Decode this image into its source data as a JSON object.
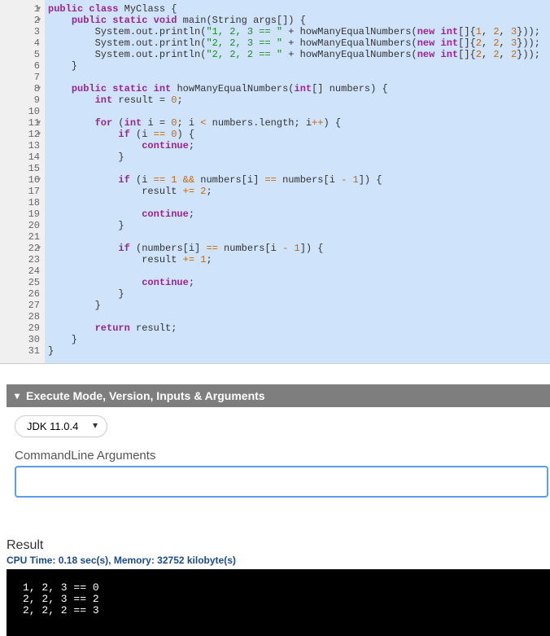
{
  "editor": {
    "gutter": [
      {
        "n": 1,
        "fold": true
      },
      {
        "n": 2,
        "fold": true
      },
      {
        "n": 3,
        "fold": false
      },
      {
        "n": 4,
        "fold": false
      },
      {
        "n": 5,
        "fold": false
      },
      {
        "n": 6,
        "fold": false
      },
      {
        "n": 7,
        "fold": false
      },
      {
        "n": 8,
        "fold": true
      },
      {
        "n": 9,
        "fold": false
      },
      {
        "n": 10,
        "fold": false
      },
      {
        "n": 11,
        "fold": true
      },
      {
        "n": 12,
        "fold": true
      },
      {
        "n": 13,
        "fold": false
      },
      {
        "n": 14,
        "fold": false
      },
      {
        "n": 15,
        "fold": false
      },
      {
        "n": 16,
        "fold": true
      },
      {
        "n": 17,
        "fold": false
      },
      {
        "n": 18,
        "fold": false
      },
      {
        "n": 19,
        "fold": false
      },
      {
        "n": 20,
        "fold": false
      },
      {
        "n": 21,
        "fold": false
      },
      {
        "n": 22,
        "fold": true
      },
      {
        "n": 23,
        "fold": false
      },
      {
        "n": 24,
        "fold": false
      },
      {
        "n": 25,
        "fold": false
      },
      {
        "n": 26,
        "fold": false
      },
      {
        "n": 27,
        "fold": false
      },
      {
        "n": 28,
        "fold": false
      },
      {
        "n": 29,
        "fold": false
      },
      {
        "n": 30,
        "fold": false
      },
      {
        "n": 31,
        "fold": false
      }
    ],
    "code": {
      "l1": {
        "a": "public ",
        "b": "class ",
        "c": "MyClass {"
      },
      "l2": {
        "a": "    ",
        "b": "public ",
        "c": "static ",
        "d": "void ",
        "e": "main(String args[]) {"
      },
      "l3": {
        "a": "        System.out.println(",
        "b": "\"1, 2, 3 == \"",
        "c": " + howManyEqualNumbers(",
        "d": "new ",
        "e": "int",
        "f": "[]{",
        "g": "1",
        "h": ", ",
        "i": "2",
        "j": ", ",
        "k": "3",
        "l": "}));"
      },
      "l4": {
        "a": "        System.out.println(",
        "b": "\"2, 2, 3 == \"",
        "c": " + howManyEqualNumbers(",
        "d": "new ",
        "e": "int",
        "f": "[]{",
        "g": "2",
        "h": ", ",
        "i": "2",
        "j": ", ",
        "k": "3",
        "l": "}));"
      },
      "l5": {
        "a": "        System.out.println(",
        "b": "\"2, 2, 2 == \"",
        "c": " + howManyEqualNumbers(",
        "d": "new ",
        "e": "int",
        "f": "[]{",
        "g": "2",
        "h": ", ",
        "i": "2",
        "j": ", ",
        "k": "2",
        "l": "}));"
      },
      "l6": {
        "a": "    }"
      },
      "l7": {
        "a": ""
      },
      "l8": {
        "a": "    ",
        "b": "public ",
        "c": "static ",
        "d": "int ",
        "e": "howManyEqualNumbers(",
        "f": "int",
        "g": "[] numbers) {"
      },
      "l9": {
        "a": "        ",
        "b": "int ",
        "c": "result = ",
        "d": "0",
        "e": ";"
      },
      "l10": {
        "a": ""
      },
      "l11": {
        "a": "        ",
        "b": "for ",
        "c": "(",
        "d": "int ",
        "e": "i = ",
        "f": "0",
        "g": "; i ",
        "h": "<",
        "i": " numbers.length; i",
        "j": "++",
        "k": ") {"
      },
      "l12": {
        "a": "            ",
        "b": "if ",
        "c": "(i ",
        "d": "==",
        "e": " ",
        "f": "0",
        "g": ") {"
      },
      "l13": {
        "a": "                ",
        "b": "continue",
        "c": ";"
      },
      "l14": {
        "a": "            }"
      },
      "l15": {
        "a": ""
      },
      "l16": {
        "a": "            ",
        "b": "if ",
        "c": "(i ",
        "d": "==",
        "e": " ",
        "f": "1",
        "g": " ",
        "h": "&&",
        "i": " numbers[i] ",
        "j": "==",
        "k": " numbers[i ",
        "l": "-",
        "m": " ",
        "n": "1",
        "o": "]) {"
      },
      "l17": {
        "a": "                result ",
        "b": "+=",
        "c": " ",
        "d": "2",
        "e": ";"
      },
      "l18": {
        "a": ""
      },
      "l19": {
        "a": "                ",
        "b": "continue",
        "c": ";"
      },
      "l20": {
        "a": "            }"
      },
      "l21": {
        "a": ""
      },
      "l22": {
        "a": "            ",
        "b": "if ",
        "c": "(numbers[i] ",
        "d": "==",
        "e": " numbers[i ",
        "f": "-",
        "g": " ",
        "h": "1",
        "i": "]) {"
      },
      "l23": {
        "a": "                result ",
        "b": "+=",
        "c": " ",
        "d": "1",
        "e": ";"
      },
      "l24": {
        "a": ""
      },
      "l25": {
        "a": "                ",
        "b": "continue",
        "c": ";"
      },
      "l26": {
        "a": "            }"
      },
      "l27": {
        "a": "        }"
      },
      "l28": {
        "a": ""
      },
      "l29": {
        "a": "        ",
        "b": "return ",
        "c": "result;"
      },
      "l30": {
        "a": "    }"
      },
      "l31": {
        "a": "}"
      }
    }
  },
  "panel": {
    "title": "Execute Mode, Version, Inputs & Arguments",
    "jdk_selected": "JDK 11.0.4",
    "cmd_label": "CommandLine Arguments",
    "cmd_value": ""
  },
  "result": {
    "title": "Result",
    "meta": "CPU Time: 0.18 sec(s), Memory: 32752 kilobyte(s)",
    "output": "1, 2, 3 == 0\n2, 2, 3 == 2\n2, 2, 2 == 3"
  }
}
